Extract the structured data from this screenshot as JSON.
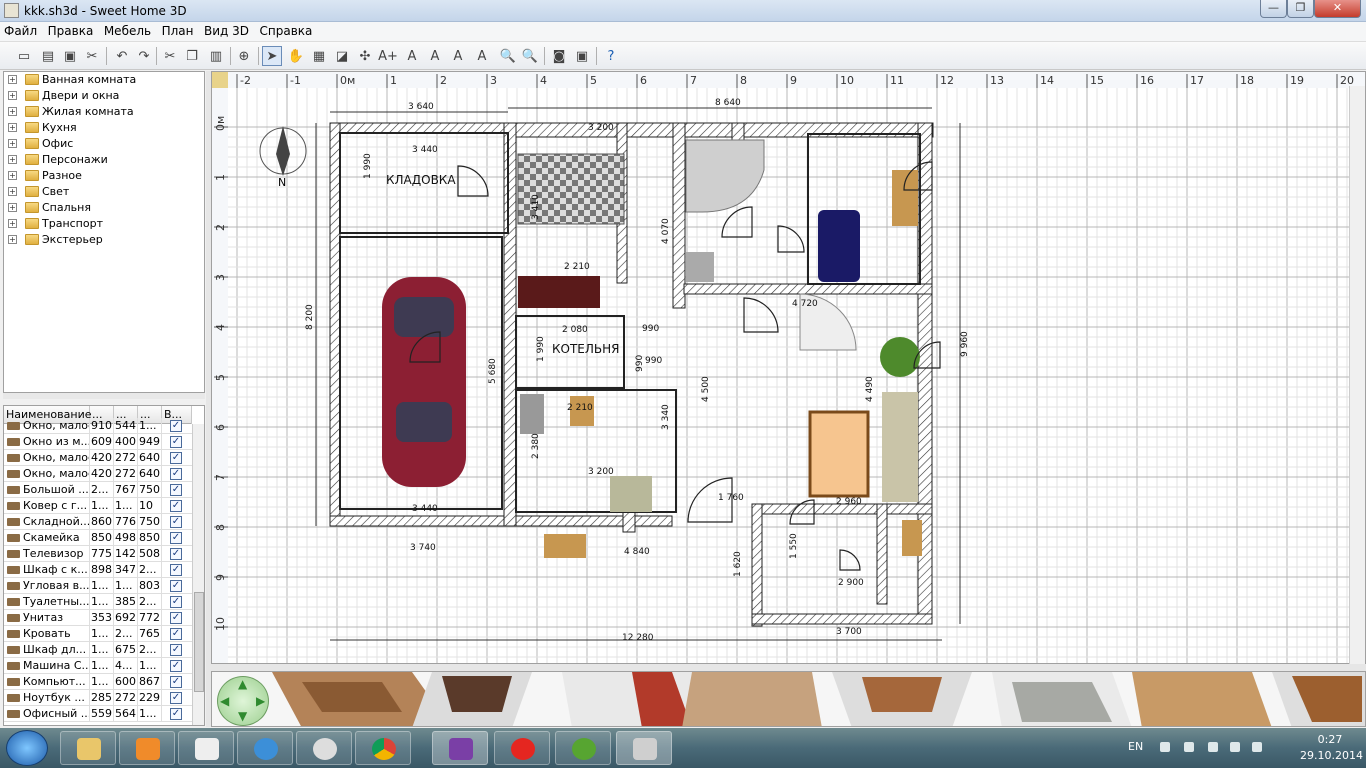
{
  "window": {
    "title": "kkk.sh3d - Sweet Home 3D",
    "min_label": "—",
    "max_label": "❐",
    "close_label": "✕"
  },
  "menu": [
    "Файл",
    "Правка",
    "Мебель",
    "План",
    "Вид 3D",
    "Справка"
  ],
  "toolbar_icons": [
    "new-icon",
    "open-icon",
    "save-icon",
    "cut-prefs-icon",
    "undo-icon",
    "redo-icon",
    "cut-icon",
    "copy-icon",
    "paste-icon",
    "add-furniture-icon",
    "select-icon",
    "pan-icon",
    "create-walls-icon",
    "create-rooms-icon",
    "create-dimensions-icon",
    "add-text-icon",
    "text-style-icon",
    "text-size-icon",
    "text-italic-icon",
    "zoom-in-icon",
    "zoom-out-icon",
    "create-photo-icon",
    "export-icon",
    "help-icon"
  ],
  "catalog": [
    "Ванная комната",
    "Двери и окна",
    "Жилая комната",
    "Кухня",
    "Офис",
    "Персонажи",
    "Разное",
    "Свет",
    "Спальня",
    "Транспорт",
    "Экстерьер"
  ],
  "furniture_table": {
    "headers": [
      "Наименование",
      "...",
      "...",
      "...",
      "В..."
    ],
    "rows": [
      [
        "Окно, малое",
        "910",
        "544",
        "1..."
      ],
      [
        "Окно из м...",
        "609",
        "400",
        "949"
      ],
      [
        "Окно, малое",
        "420",
        "272",
        "640"
      ],
      [
        "Окно, малое",
        "420",
        "272",
        "640"
      ],
      [
        "Большой ...",
        "2...",
        "767",
        "750"
      ],
      [
        "Ковер с г...",
        "1...",
        "1...",
        "10"
      ],
      [
        "Складной...",
        "860",
        "776",
        "750"
      ],
      [
        "Скамейка",
        "850",
        "498",
        "850"
      ],
      [
        "Телевизор",
        "775",
        "142",
        "508"
      ],
      [
        "Шкаф с к...",
        "898",
        "347",
        "2..."
      ],
      [
        "Угловая в...",
        "1...",
        "1...",
        "803"
      ],
      [
        "Туалетны...",
        "1...",
        "385",
        "2..."
      ],
      [
        "Унитаз",
        "353",
        "692",
        "772"
      ],
      [
        "Кровать",
        "1...",
        "2...",
        "765"
      ],
      [
        "Шкаф дл...",
        "1...",
        "675",
        "2..."
      ],
      [
        "Машина С...",
        "1...",
        "4...",
        "1..."
      ],
      [
        "Компьют...",
        "1...",
        "600",
        "867"
      ],
      [
        "Ноутбук ...",
        "285",
        "272",
        "229"
      ],
      [
        "Офисный ...",
        "559",
        "564",
        "1..."
      ]
    ],
    "check": "✓"
  },
  "plan": {
    "ruler_x": [
      "-2",
      "-1",
      "0м",
      "1",
      "2",
      "3",
      "4",
      "5",
      "6",
      "7",
      "8",
      "9",
      "10",
      "11",
      "12",
      "13",
      "14",
      "15",
      "16",
      "17",
      "18",
      "19",
      "20"
    ],
    "ruler_y": [
      "0м",
      "1",
      "2",
      "3",
      "4",
      "5",
      "6",
      "7",
      "8",
      "9",
      "10"
    ],
    "rooms": [
      "КЛАДОВКА",
      "КОТЕЛЬНЯ"
    ],
    "dimensions": [
      "3 640",
      "8 640",
      "3 440",
      "3 200",
      "1 990",
      "3 410",
      "4 070",
      "2 210",
      "2 080",
      "990",
      "990",
      "1 990",
      "990",
      "2 210",
      "2 380",
      "3 340",
      "3 200",
      "4 720",
      "4 500",
      "4 490",
      "9 960",
      "8 200",
      "5 680",
      "3 440",
      "3 740",
      "4 840",
      "1 760",
      "2 960",
      "1 620",
      "1 550",
      "2 900",
      "3 700",
      "12 280"
    ],
    "compass_label": "N"
  },
  "taskbar": {
    "apps": [
      "explorer",
      "media-player",
      "notepad",
      "internet-explorer",
      "opera",
      "chrome",
      "visual-studio",
      "yandex-browser",
      "utorrent",
      "sweet-home-3d"
    ],
    "lang": "EN",
    "time": "0:27",
    "date": "29.10.2014"
  }
}
